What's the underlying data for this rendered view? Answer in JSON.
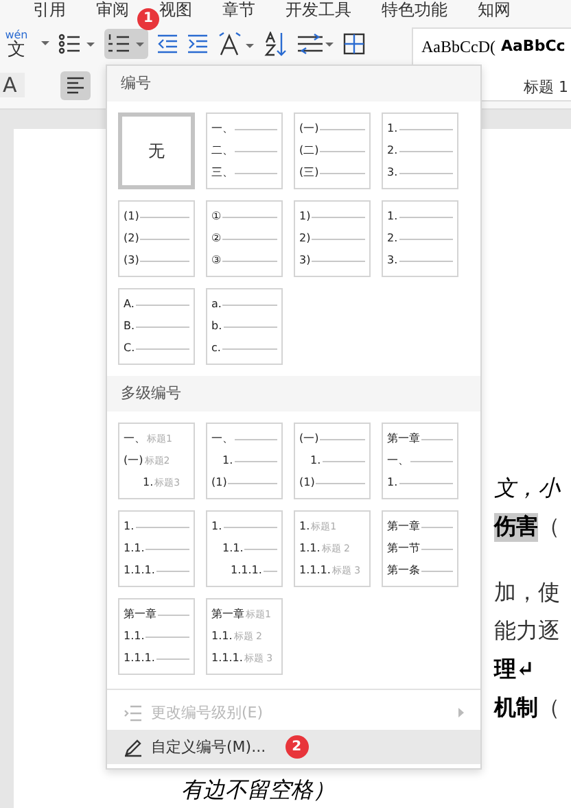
{
  "menu_tabs": [
    "引用",
    "审阅",
    "视图",
    "章节",
    "开发工具",
    "特色功能",
    "知网"
  ],
  "toolbar": {
    "pinyin": "wén",
    "pinyin_char": "文",
    "font_char": "A",
    "numbering_active": true,
    "numbering_badge": "1",
    "align_left_active": true
  },
  "styles": [
    {
      "preview": "AaBbCcD(",
      "bold": false
    },
    {
      "preview": "AaBbCc",
      "bold": true
    }
  ],
  "style_labels": [
    "标题 1"
  ],
  "dropdown": {
    "sections": [
      {
        "title": "编号",
        "tiles": [
          {
            "kind": "none",
            "selected": true,
            "lines": [
              {
                "label": "无"
              }
            ]
          },
          {
            "kind": "list",
            "selected": false,
            "lines": [
              {
                "label": "一、",
                "kind": "flat"
              },
              {
                "label": "二、",
                "kind": "flat"
              },
              {
                "label": "三、",
                "kind": "flat"
              }
            ]
          },
          {
            "kind": "list",
            "selected": false,
            "lines": [
              {
                "label": "(一)",
                "kind": "flat"
              },
              {
                "label": "(二)",
                "kind": "flat"
              },
              {
                "label": "(三)",
                "kind": "flat"
              }
            ]
          },
          {
            "kind": "list",
            "selected": false,
            "lines": [
              {
                "label": "1.",
                "kind": "flat"
              },
              {
                "label": "2.",
                "kind": "flat"
              },
              {
                "label": "3.",
                "kind": "flat"
              }
            ]
          },
          {
            "kind": "list",
            "selected": false,
            "lines": [
              {
                "label": "(1)",
                "kind": "flat"
              },
              {
                "label": "(2)",
                "kind": "flat"
              },
              {
                "label": "(3)",
                "kind": "flat"
              }
            ]
          },
          {
            "kind": "list",
            "selected": false,
            "lines": [
              {
                "label": "①",
                "kind": "flat"
              },
              {
                "label": "②",
                "kind": "flat"
              },
              {
                "label": "③",
                "kind": "flat"
              }
            ]
          },
          {
            "kind": "list",
            "selected": false,
            "lines": [
              {
                "label": "1)",
                "kind": "flat"
              },
              {
                "label": "2)",
                "kind": "flat"
              },
              {
                "label": "3)",
                "kind": "flat"
              }
            ]
          },
          {
            "kind": "list",
            "selected": false,
            "lines": [
              {
                "label": "1.",
                "kind": "flat"
              },
              {
                "label": "2.",
                "kind": "flat"
              },
              {
                "label": "3.",
                "kind": "flat"
              }
            ]
          },
          {
            "kind": "list",
            "selected": false,
            "lines": [
              {
                "label": "A.",
                "kind": "flat"
              },
              {
                "label": "B.",
                "kind": "flat"
              },
              {
                "label": "C.",
                "kind": "flat"
              }
            ]
          },
          {
            "kind": "list",
            "selected": false,
            "lines": [
              {
                "label": "a.",
                "kind": "flat"
              },
              {
                "label": "b.",
                "kind": "flat"
              },
              {
                "label": "c.",
                "kind": "flat"
              }
            ]
          }
        ]
      },
      {
        "title": "多级编号",
        "tiles": [
          {
            "kind": "list",
            "selected": false,
            "lines": [
              {
                "label": "一、",
                "heading": "标题1",
                "kind": "flat"
              },
              {
                "label": "(一)",
                "heading": "标题2",
                "kind": "flat"
              },
              {
                "label": "1.",
                "heading": "标题3",
                "kind": "deep"
              }
            ]
          },
          {
            "kind": "list",
            "selected": false,
            "lines": [
              {
                "label": "一、",
                "kind": "flat"
              },
              {
                "label": "1.",
                "kind": "step"
              },
              {
                "label": "(1)",
                "kind": "flat"
              }
            ]
          },
          {
            "kind": "list",
            "selected": false,
            "lines": [
              {
                "label": "(一)",
                "kind": "flat"
              },
              {
                "label": "1.",
                "kind": "step"
              },
              {
                "label": "(1)",
                "kind": "flat"
              }
            ]
          },
          {
            "kind": "list",
            "selected": false,
            "lines": [
              {
                "label": "第一章",
                "kind": "flat"
              },
              {
                "label": "一、",
                "kind": "flat"
              },
              {
                "label": "1.",
                "kind": "flat"
              }
            ]
          },
          {
            "kind": "list",
            "selected": false,
            "lines": [
              {
                "label": "1.",
                "kind": "flat"
              },
              {
                "label": "1.1.",
                "kind": "flat"
              },
              {
                "label": "1.1.1.",
                "kind": "flat"
              }
            ]
          },
          {
            "kind": "list",
            "selected": false,
            "lines": [
              {
                "label": "1.",
                "kind": "flat"
              },
              {
                "label": "1.1.",
                "kind": "step"
              },
              {
                "label": "1.1.1.",
                "kind": "deep"
              }
            ]
          },
          {
            "kind": "list",
            "selected": false,
            "lines": [
              {
                "label": "1.",
                "heading": "标题1",
                "kind": "flat"
              },
              {
                "label": "1.1.",
                "heading": "标题 2",
                "kind": "flat"
              },
              {
                "label": "1.1.1.",
                "heading": "标题 3",
                "kind": "flat"
              }
            ]
          },
          {
            "kind": "list",
            "selected": false,
            "lines": [
              {
                "label": "第一章",
                "kind": "flat"
              },
              {
                "label": "第一节",
                "kind": "flat"
              },
              {
                "label": "第一条",
                "kind": "flat"
              }
            ]
          },
          {
            "kind": "list",
            "selected": false,
            "lines": [
              {
                "label": "第一章",
                "kind": "flat"
              },
              {
                "label": "1.1.",
                "kind": "flat"
              },
              {
                "label": "1.1.1.",
                "kind": "flat"
              }
            ]
          },
          {
            "kind": "list",
            "selected": false,
            "lines": [
              {
                "label": "第一章",
                "heading": "标题1",
                "kind": "flat"
              },
              {
                "label": "1.1.",
                "heading": "标题 2",
                "kind": "flat"
              },
              {
                "label": "1.1.1.",
                "heading": "标题 3",
                "kind": "flat"
              }
            ]
          }
        ]
      }
    ],
    "items": [
      {
        "kind": "levels",
        "label": "更改编号级别(E)",
        "disabled": true,
        "highlighted": false,
        "submenu": true
      },
      {
        "kind": "custom",
        "label": "自定义编号(M)...",
        "disabled": false,
        "highlighted": true,
        "submenu": false,
        "badge": "2"
      }
    ]
  },
  "document": {
    "lines": [
      {
        "runs": [
          {
            "text": "文，小",
            "kind": "italic"
          }
        ]
      },
      {
        "runs": [
          {
            "text": "伤害",
            "kind": "marked"
          },
          {
            "text": "（",
            "kind": "plain"
          }
        ]
      },
      {
        "runs": [
          {
            "text": "加，使",
            "kind": "plain"
          }
        ]
      },
      {
        "runs": [
          {
            "text": "能力逐",
            "kind": "plain"
          }
        ]
      },
      {
        "runs": [
          {
            "text": "理↵",
            "kind": "bold"
          }
        ]
      },
      {
        "runs": [
          {
            "text": "机制",
            "kind": "bold"
          },
          {
            "text": "（",
            "kind": "plain"
          }
        ]
      }
    ],
    "footer": {
      "text": "有边不留空格）",
      "kind": "italic"
    }
  }
}
